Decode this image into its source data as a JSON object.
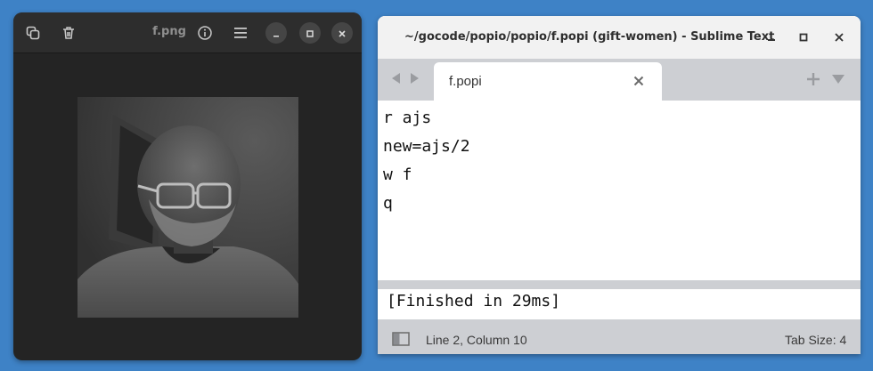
{
  "image_viewer": {
    "title": "f.png",
    "icons": {
      "copy": "copy-icon",
      "delete": "trash-icon",
      "info": "info-icon",
      "menu": "hamburger-menu-icon",
      "minimize": "minimize-icon",
      "maximize": "maximize-icon",
      "close": "close-icon"
    },
    "image_subject": "grayscale portrait photo"
  },
  "sublime": {
    "title": "~/gocode/popio/popio/f.popi (gift-women) - Sublime Text",
    "tab": {
      "label": "f.popi"
    },
    "code_lines": [
      "r ajs",
      "new=ajs/2",
      "w f",
      "q"
    ],
    "output": "[Finished in 29ms]",
    "status": {
      "position": "Line 2, Column 10",
      "tab_size": "Tab Size: 4"
    }
  },
  "colors": {
    "desktop": "#3e82c6",
    "viewer_bg": "#242424",
    "sublime_chrome": "#cdcfd3"
  }
}
